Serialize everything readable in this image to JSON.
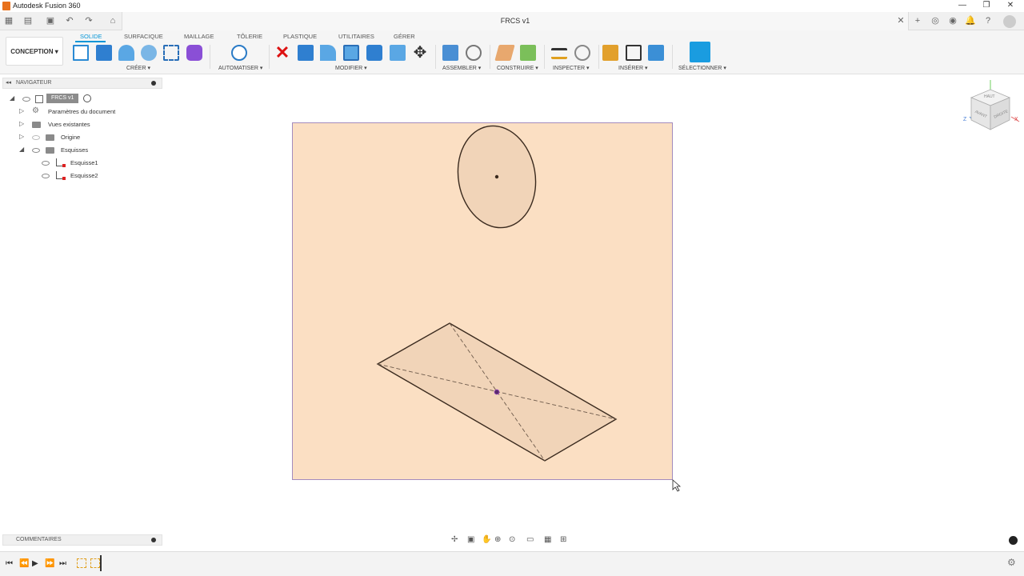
{
  "window": {
    "app_title": "Autodesk Fusion 360",
    "minimize": "—",
    "restore": "❐",
    "close": "✕"
  },
  "document": {
    "title": "FRCS v1",
    "tab_close": "✕"
  },
  "toolbar": {
    "workspace": "CONCEPTION ▾",
    "tabs": [
      "SOLIDE",
      "SURFACIQUE",
      "MAILLAGE",
      "TÔLERIE",
      "PLASTIQUE",
      "UTILITAIRES",
      "GÉRER"
    ],
    "groups": [
      "CRÉER ▾",
      "AUTOMATISER ▾",
      "MODIFIER ▾",
      "ASSEMBLER ▾",
      "CONSTRUIRE ▾",
      "INSPECTER ▾",
      "INSÉRER ▾",
      "SÉLECTIONNER ▾"
    ]
  },
  "navigator": {
    "title": "NAVIGATEUR",
    "root": "FRCS v1",
    "items": [
      {
        "label": "Paramètres du document"
      },
      {
        "label": "Vues existantes"
      },
      {
        "label": "Origine"
      },
      {
        "label": "Esquisses"
      },
      {
        "label": "Esquisse1"
      },
      {
        "label": "Esquisse2"
      }
    ]
  },
  "viewcube": {
    "top": "HAUT",
    "front": "AVANT",
    "right": "DROITE",
    "axis_x": "X",
    "axis_z": "Z"
  },
  "comments": {
    "title": "COMMENTAIRES"
  },
  "colors": {
    "accent": "#0696d7",
    "sketch_plane": "#fbdfc3",
    "profile_fill": "#f1d4b8",
    "sketch_line": "#3a2a1e"
  }
}
